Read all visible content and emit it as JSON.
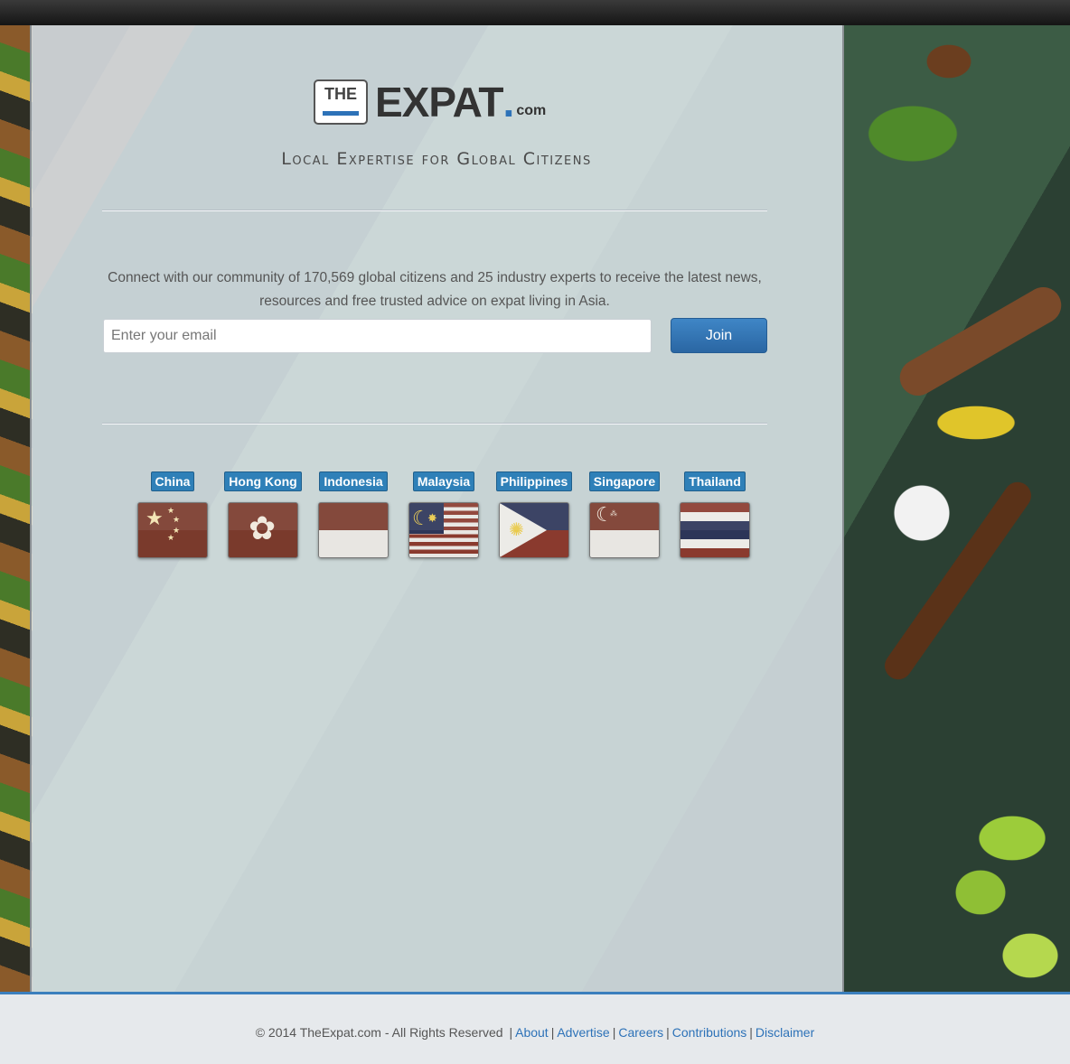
{
  "brand": {
    "logo_the": "THE",
    "logo_expat": "EXPAT",
    "logo_dot": ".",
    "logo_com": "com",
    "tagline": "Local Expertise for Global Citizens",
    "accent_color": "#2d72b8"
  },
  "signup": {
    "intro_text": "Connect with our community of 170,569 global citizens and 25 industry experts to receive the latest news, resources and free trusted advice on expat living in Asia.",
    "email_placeholder": "Enter your email",
    "join_label": "Join"
  },
  "countries": [
    {
      "label": "China",
      "icon": "china-flag-icon"
    },
    {
      "label": "Hong Kong",
      "icon": "hong-kong-flag-icon"
    },
    {
      "label": "Indonesia",
      "icon": "indonesia-flag-icon"
    },
    {
      "label": "Malaysia",
      "icon": "malaysia-flag-icon"
    },
    {
      "label": "Philippines",
      "icon": "philippines-flag-icon"
    },
    {
      "label": "Singapore",
      "icon": "singapore-flag-icon"
    },
    {
      "label": "Thailand",
      "icon": "thailand-flag-icon"
    }
  ],
  "footer": {
    "copyright": "© 2014 TheExpat.com - All Rights Reserved",
    "links": [
      "About",
      "Advertise",
      "Careers",
      "Contributions",
      "Disclaimer"
    ]
  }
}
